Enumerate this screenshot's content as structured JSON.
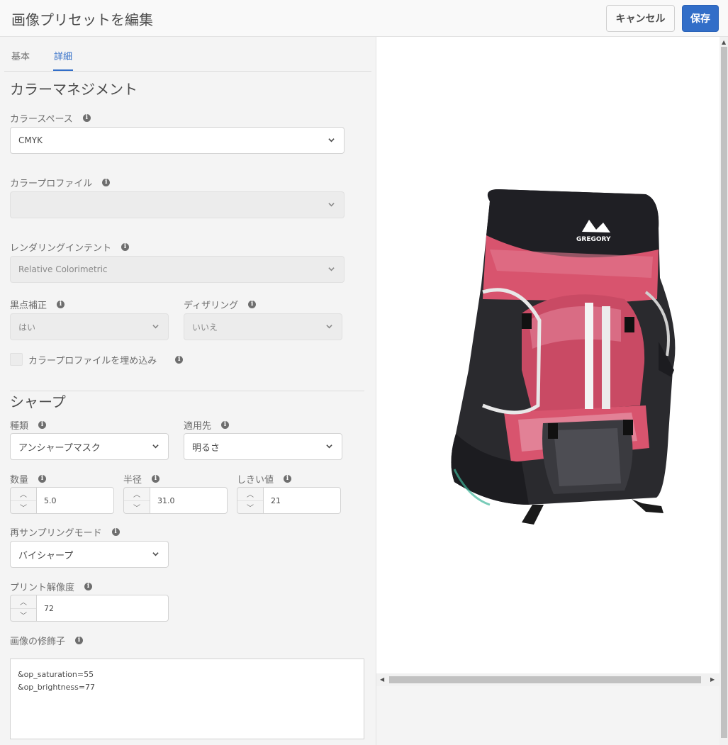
{
  "header": {
    "title": "画像プリセットを編集",
    "cancel_label": "キャンセル",
    "save_label": "保存"
  },
  "tabs": [
    {
      "label": "基本",
      "active": false
    },
    {
      "label": "詳細",
      "active": true
    }
  ],
  "color_management": {
    "title": "カラーマネジメント",
    "color_space": {
      "label": "カラースペース",
      "value": "CMYK"
    },
    "color_profile": {
      "label": "カラープロファイル",
      "value": ""
    },
    "rendering_intent": {
      "label": "レンダリングインテント",
      "value": "Relative Colorimetric"
    },
    "black_point": {
      "label": "黒点補正",
      "value": "はい"
    },
    "dithering": {
      "label": "ディザリング",
      "value": "いいえ"
    },
    "embed_profile": {
      "label": "カラープロファイルを埋め込み",
      "checked": false
    }
  },
  "sharpen": {
    "title": "シャープ",
    "type": {
      "label": "種類",
      "value": "アンシャープマスク"
    },
    "apply_to": {
      "label": "適用先",
      "value": "明るさ"
    },
    "amount": {
      "label": "数量",
      "value": "5.0"
    },
    "radius": {
      "label": "半径",
      "value": "31.0"
    },
    "threshold": {
      "label": "しきい値",
      "value": "21"
    },
    "resampling": {
      "label": "再サンプリングモード",
      "value": "バイシャープ"
    },
    "print_resolution": {
      "label": "プリント解像度",
      "value": "72"
    },
    "modifiers": {
      "label": "画像の修飾子",
      "line1": "&op_saturation=55",
      "line2": "&op_brightness=77"
    }
  },
  "preview": {
    "brand_text": "GREGORY",
    "colors": {
      "accent": "#326ec8",
      "pack_red": "#d8546e",
      "pack_dark": "#2a2a2e"
    }
  }
}
